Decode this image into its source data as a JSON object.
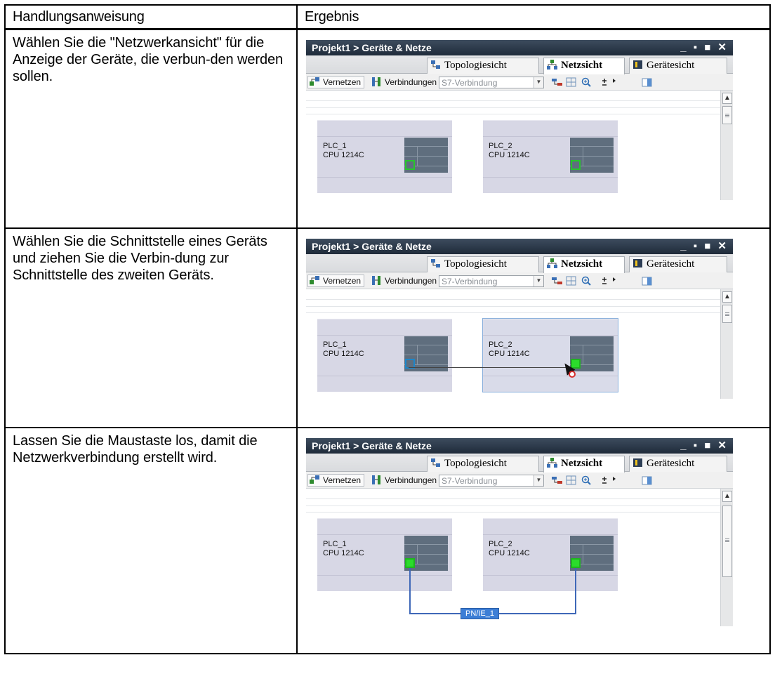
{
  "table": {
    "header": {
      "instruction": "Handlungsanweisung",
      "result": "Ergebnis"
    },
    "rows": [
      {
        "instruction": "Wählen Sie die \"Netzwerkansicht\" für die Anzeige der Geräte, die verbun-den werden sollen."
      },
      {
        "instruction": "Wählen Sie die Schnittstelle eines Geräts und ziehen Sie die Verbin-dung zur Schnittstelle des zweiten Geräts."
      },
      {
        "instruction": "Lassen Sie die Maustaste los, damit die Netzwerkverbindung erstellt wird."
      }
    ]
  },
  "window": {
    "title": "Projekt1 > Geräte & Netze",
    "window_buttons": "_ ▪ ■ ✕",
    "tabs": [
      "Topologiesicht",
      "Netzsicht",
      "Gerätesicht"
    ],
    "active_tab": "Netzsicht",
    "toolbar": {
      "vernetzen": "Vernetzen",
      "verbindungen": "Verbindungen",
      "connection_type": "S7-Verbindung"
    },
    "devices": [
      {
        "name": "PLC_1",
        "cpu": "CPU 1214C"
      },
      {
        "name": "PLC_2",
        "cpu": "CPU 1214C"
      }
    ],
    "network_label": "PN/IE_1"
  },
  "colors": {
    "titlebar": "#2b3848",
    "device_bg": "#d7d7e5",
    "rack": "#5f6e7e",
    "port_green": "#2bdc2b",
    "link_blue": "#3f68b8"
  }
}
